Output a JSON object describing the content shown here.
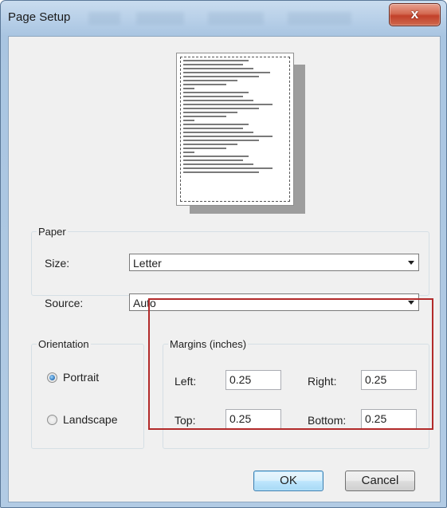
{
  "window": {
    "title": "Page Setup",
    "close_symbol": "x"
  },
  "paper": {
    "legend": "Paper",
    "size_label": "Size:",
    "size_value": "Letter",
    "source_label": "Source:",
    "source_value": "Auto"
  },
  "orientation": {
    "legend": "Orientation",
    "options": [
      {
        "label": "Portrait",
        "selected": true
      },
      {
        "label": "Landscape",
        "selected": false
      }
    ]
  },
  "margins": {
    "legend": "Margins (inches)",
    "left_label": "Left:",
    "left_value": "0.25",
    "right_label": "Right:",
    "right_value": "0.25",
    "top_label": "Top:",
    "top_value": "0.25",
    "bottom_label": "Bottom:",
    "bottom_value": "0.25"
  },
  "buttons": {
    "ok": "OK",
    "cancel": "Cancel"
  },
  "colors": {
    "highlight": "#b22a2a",
    "close_button": "#c2402a"
  }
}
